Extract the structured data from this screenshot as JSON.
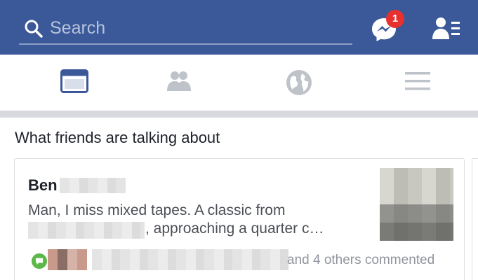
{
  "header": {
    "search_placeholder": "Search",
    "messenger_badge": "1",
    "icons": [
      "search-icon",
      "messenger-icon",
      "friend-requests-icon"
    ],
    "bar_color": "#3b5998"
  },
  "tabs": [
    {
      "icon": "news-feed-icon",
      "active": true
    },
    {
      "icon": "friends-icon",
      "active": false
    },
    {
      "icon": "globe-icon",
      "active": false
    },
    {
      "icon": "menu-icon",
      "active": false
    }
  ],
  "feed": {
    "section_title": "What friends are talking about",
    "post": {
      "author_first": "Ben",
      "text_line1": "Man, I miss mixed tapes. A classic from",
      "text_line2": ", approaching a quarter c…",
      "commenters_suffix": "and 4 others commented"
    }
  }
}
